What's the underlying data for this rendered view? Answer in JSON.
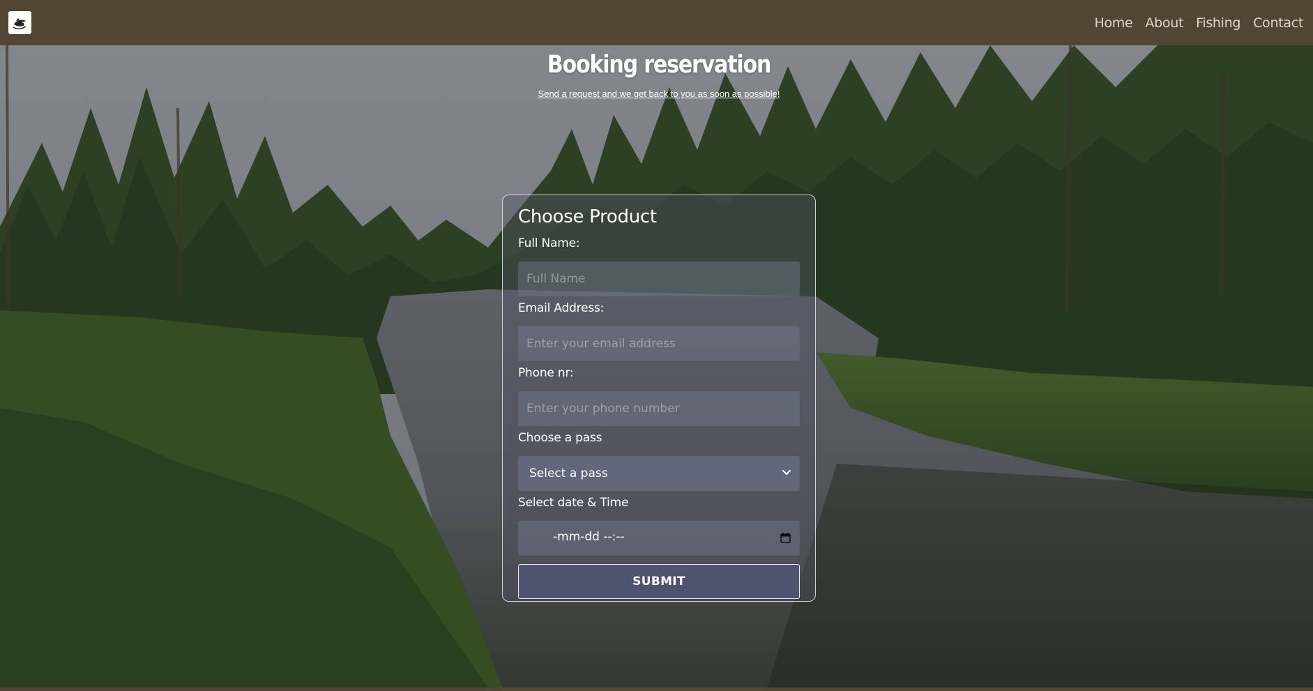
{
  "nav": {
    "logo_icon": "fish-logo-icon",
    "links": [
      {
        "label": "Home"
      },
      {
        "label": "About"
      },
      {
        "label": "Fishing"
      },
      {
        "label": "Contact"
      }
    ]
  },
  "header": {
    "title": "Booking reservation",
    "subtitle": "Send a request and we get back to you as soon as possible!"
  },
  "form": {
    "title": "Choose Product",
    "full_name": {
      "label": "Full Name:",
      "placeholder": "Full Name",
      "value": ""
    },
    "email": {
      "label": "Email Address:",
      "placeholder": "Enter your email address",
      "value": ""
    },
    "phone": {
      "label": "Phone nr:",
      "placeholder": "Enter your phone number",
      "value": ""
    },
    "pass": {
      "label": "Choose a pass",
      "selected": "Select a pass",
      "icon": "chevron-down-icon"
    },
    "datetime": {
      "label": "Select date & Time",
      "value": "-mm-dd --:--",
      "icon": "calendar-icon"
    },
    "submit_label": "SUBMIT"
  },
  "colors": {
    "navbar": "#514534",
    "nav_link": "#ddd6cc",
    "submit_bg": "#4e5470"
  }
}
